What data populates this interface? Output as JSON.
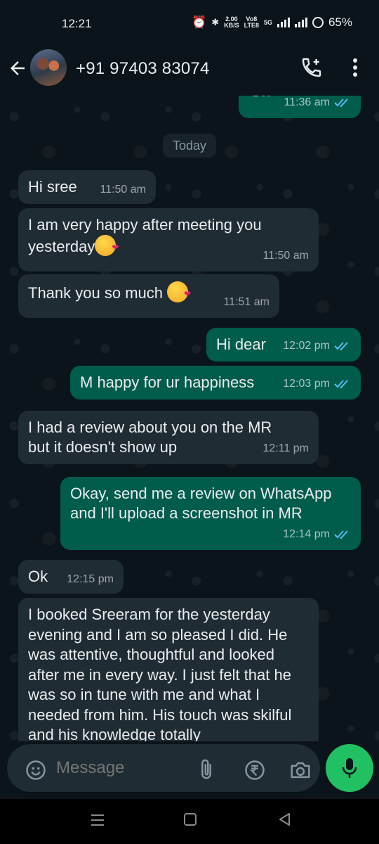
{
  "status": {
    "time": "12:21",
    "net_speed_top": "2.00",
    "net_speed_bottom": "KB/S",
    "volte_top": "Vo8",
    "volte_bottom": "LTE8",
    "network": "5G",
    "battery": "65%"
  },
  "header": {
    "contact_name": "+91 97403 83074"
  },
  "date_separator": "Today",
  "messages": [
    {
      "direction": "out",
      "text": "Ok",
      "time": "11:36 am",
      "read": true
    },
    {
      "direction": "in",
      "text": "Hi sree",
      "time": "11:50 am"
    },
    {
      "direction": "in",
      "text": "I am very happy after meeting you yesterday",
      "emoji": "kissing-face",
      "time": "11:50 am"
    },
    {
      "direction": "in",
      "text": "Thank you so much",
      "emoji": "smiling-face-with-hearts",
      "time": "11:51 am"
    },
    {
      "direction": "out",
      "text": "Hi dear",
      "time": "12:02 pm",
      "read": true
    },
    {
      "direction": "out",
      "text": "M happy for ur happiness",
      "time": "12:03 pm",
      "read": true
    },
    {
      "direction": "in",
      "text": "I had a review about you on the MR but it doesn't show up",
      "time": "12:11 pm"
    },
    {
      "direction": "out",
      "text": "Okay, send me a review on WhatsApp  and I'll upload a screenshot in MR",
      "time": "12:14 pm",
      "read": true
    },
    {
      "direction": "in",
      "text": "Ok",
      "time": "12:15 pm"
    },
    {
      "direction": "in",
      "text": "I booked Sreeram for the yesterday evening and I am so pleased I did. He was attentive, thoughtful and looked after me in every way. I just felt that he was so in tune with me and what I needed from him. His touch was skilful and his knowledge totally"
    }
  ],
  "input": {
    "placeholder": "Message"
  },
  "colors": {
    "background": "#0b141a",
    "incoming_bubble": "#202c33",
    "outgoing_bubble": "#005c4b",
    "tick_read": "#53bdeb",
    "mic_button": "#21c063"
  }
}
